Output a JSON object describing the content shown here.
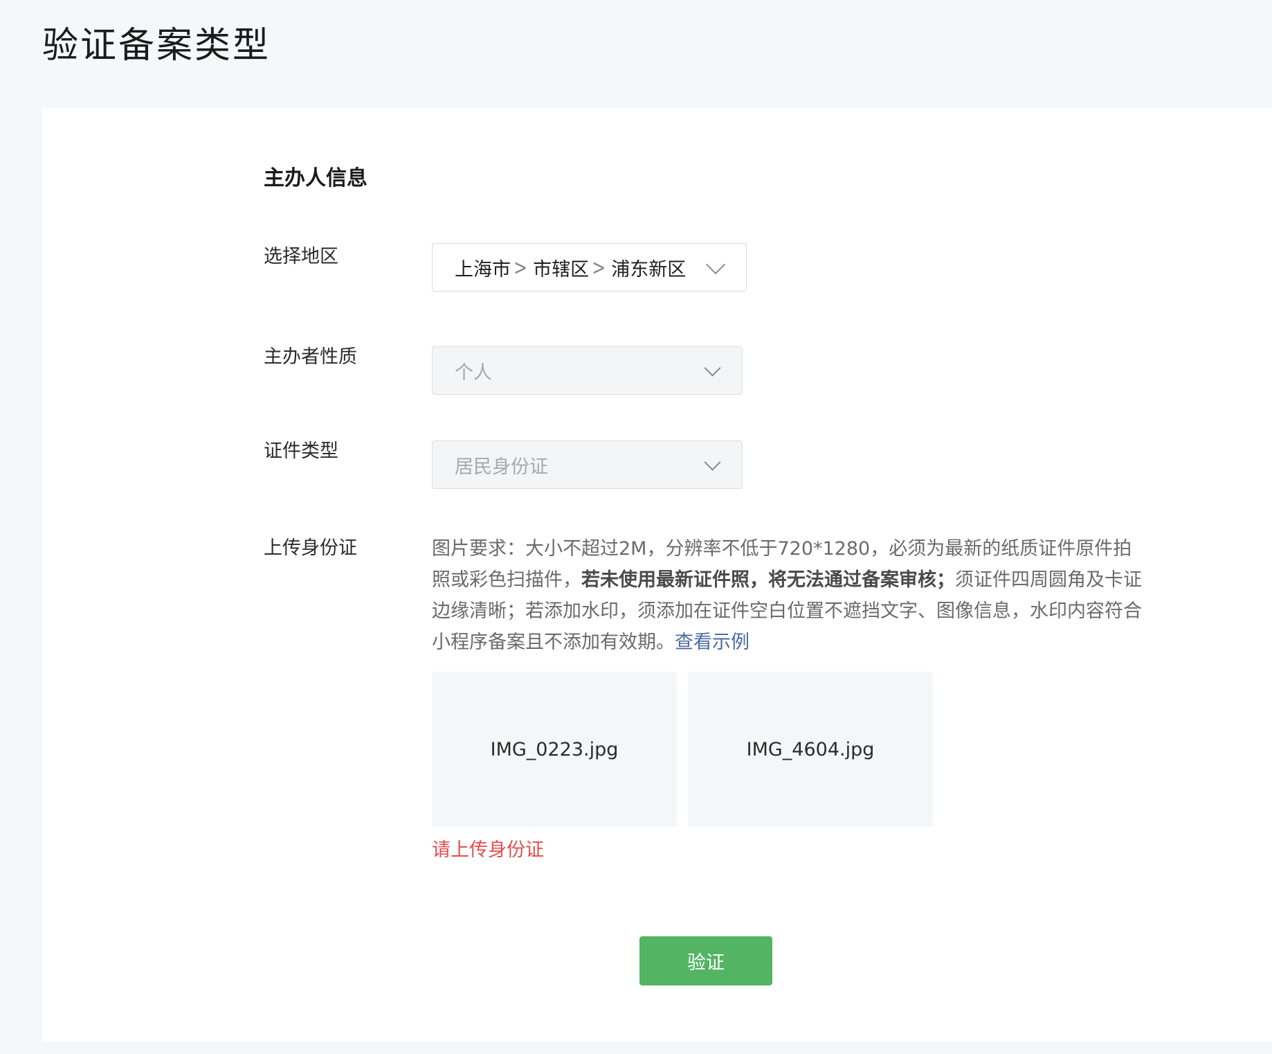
{
  "page": {
    "title": "验证备案类型"
  },
  "section": {
    "title": "主办人信息"
  },
  "region": {
    "label": "选择地区",
    "province": "上海市",
    "city": "市辖区",
    "district": "浦东新区"
  },
  "organizer_type": {
    "label": "主办者性质",
    "value": "个人"
  },
  "id_type": {
    "label": "证件类型",
    "value": "居民身份证"
  },
  "upload": {
    "label": "上传身份证",
    "requirements_part1": "图片要求：大小不超过2M，分辨率不低于720*1280，必须为最新的纸质证件原件拍照或彩色扫描件，",
    "requirements_bold": "若未使用最新证件照，将无法通过备案审核；",
    "requirements_part2": "须证件四周圆角及卡证边缘清晰；若添加水印，须添加在证件空白位置不遮挡文字、图像信息，水印内容符合小程序备案且不添加有效期。",
    "example_link": "查看示例",
    "files": [
      "IMG_0223.jpg",
      "IMG_4604.jpg"
    ],
    "error": "请上传身份证"
  },
  "actions": {
    "verify_label": "验证"
  },
  "colors": {
    "primary_button": "#53b563",
    "error": "#e74c4c",
    "link": "#4a6aa3"
  }
}
